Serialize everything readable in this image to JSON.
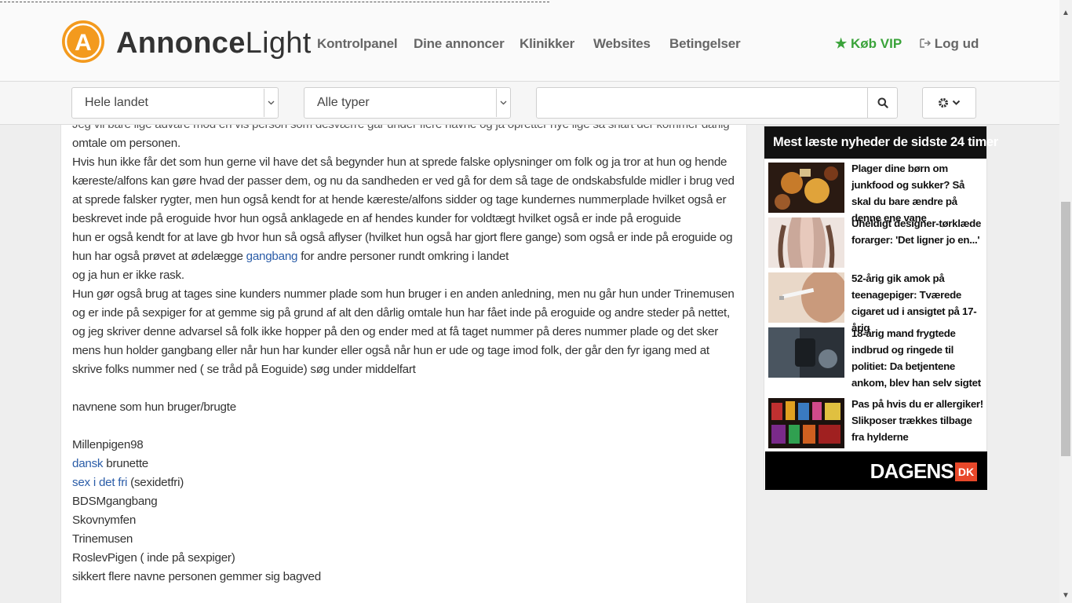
{
  "header": {
    "logo_letter": "A",
    "logo_bold": "Annonce",
    "logo_light": "Light",
    "nav": [
      {
        "label": "Kontrolpanel"
      },
      {
        "label": "Dine annoncer"
      },
      {
        "label": "Klinikker"
      },
      {
        "label": "Websites"
      },
      {
        "label": "Betingelser"
      }
    ],
    "vip_label": "Køb VIP",
    "logout_label": "Log ud",
    "brand_color": "#f39a1e",
    "vip_color": "#3aa33a"
  },
  "filters": {
    "region_value": "Hele landet",
    "type_value": "Alle typer",
    "search_value": "",
    "search_icon": "search-icon",
    "settings_icon": "gear-icon"
  },
  "post": {
    "line_cut": "Jeg vil bare lige advare mod en vis person som desværre går under flere navne og ja opretter nye lige så snart der kommer dårlig",
    "p1": "omtale om personen.",
    "p2": "Hvis hun ikke får det som hun gerne vil have det så begynder hun at sprede falske oplysninger om folk og ja tror at hun og hende kæreste/alfons kan gøre hvad der passer dem, og nu da sandheden er ved gå for dem så tage de ondskabsfulde midler i brug ved at sprede falsker rygter, men hun også kendt for at hende kæreste/alfons sidder og tage kundernes nummerplade hvilket også er beskrevet inde på eroguide hvor hun også anklagede en af hendes kunder for voldtægt hvilket også er inde på eroguide",
    "p3_before": "hun er også kendt for at lave gb hvor hun så også aflyser (hvilket hun også har gjort flere gange) som også er inde på eroguide og hun har også prøvet at ødelægge ",
    "p3_link": "gangbang",
    "p3_after": " for andre personer rundt omkring i landet",
    "p4": "og ja hun er ikke rask.",
    "p5": "Hun gør også brug at tages sine kunders nummer plade som hun bruger i en anden anledning, men nu går hun under Trinemusen og er inde på sexpiger for at gemme sig på grund af alt den dårlig omtale hun har fået inde på eroguide og andre steder på nettet,",
    "p6": "og jeg skriver denne advarsel så folk ikke hopper på den og ender med at få taget nummer på deres nummer plade og det sker mens hun holder gangbang eller når hun har kunder eller også når hun er ude og tage imod folk, der går den fyr igang med at skrive folks nummer ned ( se tråd på Eoguide) søg under middelfart",
    "names_heading": "navnene som hun bruger/brugte",
    "name1": "Millenpigen98",
    "name2_link": "dansk",
    "name2_rest": " brunette",
    "name3_link": "sex i det fri",
    "name3_rest": " (sexidetfri)",
    "name4": "BDSMgangbang",
    "name5": "Skovnymfen",
    "name6": "Trinemusen",
    "name7": "RoslevPigen ( inde på sexpiger)",
    "name8": "sikkert flere navne personen gemmer sig bagved",
    "link_color": "#2b5da8"
  },
  "widget": {
    "title": "Mest læste nyheder de sidste 24 timer",
    "items": [
      {
        "title": "Plager dine børn om junkfood og sukker? Så skal du bare ændre på denne ene vane"
      },
      {
        "title": "Uheldigt designer-tørklæde forarger: 'Det ligner jo en...'"
      },
      {
        "title": "52-årig gik amok på teenagepiger: Tværede cigaret ud i ansigtet på 17-årig"
      },
      {
        "title": "18-årig mand frygtede indbrud og ringede til politiet: Da betjentene ankom, blev han selv sigtet"
      },
      {
        "title": "Pas på hvis du er allergiker! Slikposer trækkes tilbage fra hylderne"
      }
    ],
    "logo_text": "DAGENS",
    "logo_badge": "DK",
    "badge_color": "#e8482a"
  }
}
